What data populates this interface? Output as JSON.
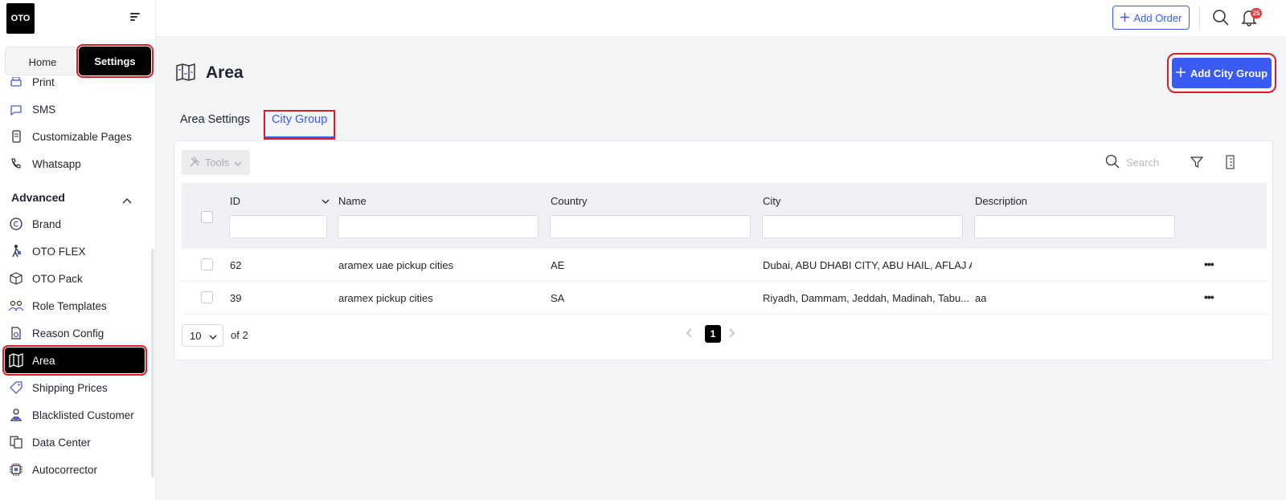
{
  "logo": {
    "text": "OTO"
  },
  "switcher": {
    "home": "Home",
    "settings": "Settings"
  },
  "sidebar": {
    "items_top": [
      {
        "label": "Print",
        "icon": "printer-icon"
      },
      {
        "label": "SMS",
        "icon": "chat-icon"
      },
      {
        "label": "Customizable Pages",
        "icon": "phone-page-icon"
      },
      {
        "label": "Whatsapp",
        "icon": "phone-icon"
      }
    ],
    "section_advanced": "Advanced",
    "items_advanced": [
      {
        "label": "Brand",
        "icon": "copyright-icon"
      },
      {
        "label": "OTO FLEX",
        "icon": "walker-icon"
      },
      {
        "label": "OTO Pack",
        "icon": "box-icon"
      },
      {
        "label": "Role Templates",
        "icon": "users-icon"
      },
      {
        "label": "Reason Config",
        "icon": "document-gear-icon"
      },
      {
        "label": "Area",
        "icon": "map-icon"
      },
      {
        "label": "Shipping Prices",
        "icon": "price-tag-icon"
      },
      {
        "label": "Blacklisted Customer",
        "icon": "person-blocked-icon"
      },
      {
        "label": "Data Center",
        "icon": "documents-icon"
      },
      {
        "label": "Autocorrector",
        "icon": "chip-icon"
      }
    ]
  },
  "topbar": {
    "add_order": "Add Order",
    "notification_count": "25"
  },
  "page": {
    "title": "Area",
    "add_city_group": "Add City Group",
    "tabs": [
      {
        "label": "Area Settings",
        "active": false
      },
      {
        "label": "City Group",
        "active": true
      }
    ]
  },
  "toolbar": {
    "tools": "Tools",
    "search_placeholder": "Search"
  },
  "table": {
    "columns": [
      "ID",
      "Name",
      "Country",
      "City",
      "Description"
    ],
    "rows": [
      {
        "id": "62",
        "name": "aramex uae pickup cities",
        "country": "AE",
        "city": "Dubai, ABU DHABI CITY, ABU HAIL, AFLAJ AL ...",
        "description": ""
      },
      {
        "id": "39",
        "name": "aramex pickup cities",
        "country": "SA",
        "city": "Riyadh, Dammam, Jeddah, Madinah, Tabu...",
        "description": "aa"
      }
    ]
  },
  "pager": {
    "page_size": "10",
    "of_total": "of 2",
    "current_page": "1"
  },
  "colors": {
    "accent": "#3a5bf0",
    "highlight": "#d81f26",
    "active_bg": "#000000"
  }
}
